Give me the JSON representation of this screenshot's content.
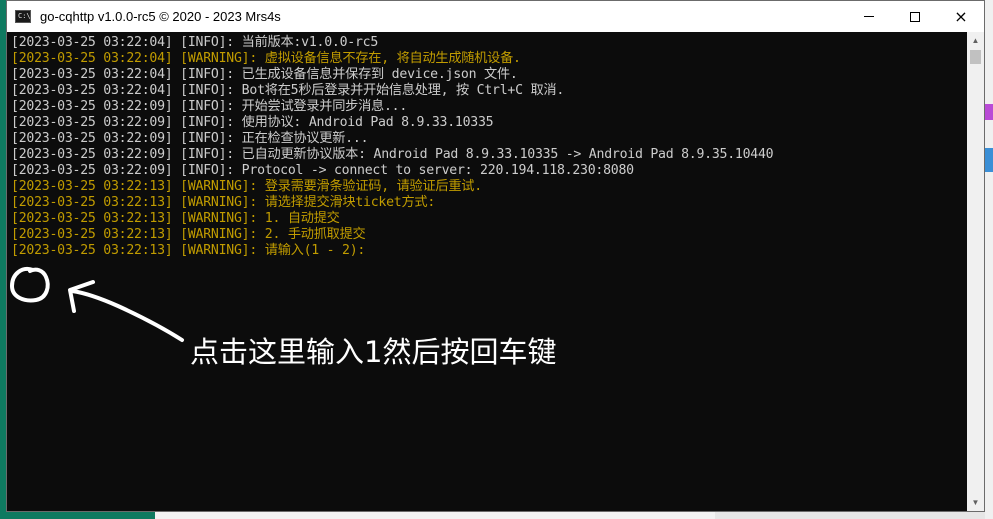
{
  "window": {
    "title": "go-cqhttp v1.0.0-rc5 © 2020 - 2023 Mrs4s",
    "icon_text": "C:\\",
    "controls": {
      "minimize": "minimize-icon",
      "maximize": "maximize-icon",
      "close": "×"
    }
  },
  "console": {
    "lines": [
      {
        "level": "info",
        "text": "[2023-03-25 03:22:04] [INFO]: 当前版本:v1.0.0-rc5"
      },
      {
        "level": "warn",
        "text": "[2023-03-25 03:22:04] [WARNING]: 虚拟设备信息不存在, 将自动生成随机设备."
      },
      {
        "level": "info",
        "text": "[2023-03-25 03:22:04] [INFO]: 已生成设备信息并保存到 device.json 文件."
      },
      {
        "level": "info",
        "text": "[2023-03-25 03:22:04] [INFO]: Bot将在5秒后登录并开始信息处理, 按 Ctrl+C 取消."
      },
      {
        "level": "info",
        "text": "[2023-03-25 03:22:09] [INFO]: 开始尝试登录并同步消息..."
      },
      {
        "level": "info",
        "text": "[2023-03-25 03:22:09] [INFO]: 使用协议: Android Pad 8.9.33.10335"
      },
      {
        "level": "info",
        "text": "[2023-03-25 03:22:09] [INFO]: 正在检查协议更新..."
      },
      {
        "level": "info",
        "text": "[2023-03-25 03:22:09] [INFO]: 已自动更新协议版本: Android Pad 8.9.33.10335 -> Android Pad 8.9.35.10440"
      },
      {
        "level": "info",
        "text": "[2023-03-25 03:22:09] [INFO]: Protocol -> connect to server: 220.194.118.230:8080"
      },
      {
        "level": "warn",
        "text": "[2023-03-25 03:22:13] [WARNING]: 登录需要滑条验证码, 请验证后重试."
      },
      {
        "level": "warn",
        "text": "[2023-03-25 03:22:13] [WARNING]: 请选择提交滑块ticket方式:"
      },
      {
        "level": "warn",
        "text": "[2023-03-25 03:22:13] [WARNING]: 1. 自动提交"
      },
      {
        "level": "warn",
        "text": "[2023-03-25 03:22:13] [WARNING]: 2. 手动抓取提交"
      },
      {
        "level": "warn",
        "text": "[2023-03-25 03:22:13] [WARNING]: 请输入(1 - 2):"
      }
    ]
  },
  "annotation": {
    "text": "点击这里输入1然后按回车键"
  },
  "colors": {
    "console_bg": "#0c0c0c",
    "info": "#cccccc",
    "warn": "#c19c00",
    "annotation": "#ffffff"
  }
}
